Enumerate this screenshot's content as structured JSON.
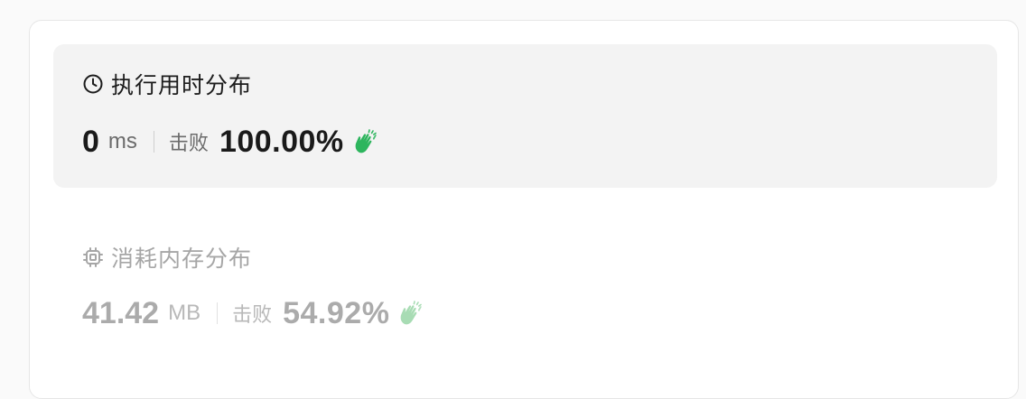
{
  "runtime": {
    "title": "执行用时分布",
    "icon": "clock-icon",
    "value": "0",
    "unit": "ms",
    "beat_label": "击败",
    "beat_percent": "100.00%",
    "clap_color": "#2db55d"
  },
  "memory": {
    "title": "消耗内存分布",
    "icon": "cpu-chip-icon",
    "value": "41.42",
    "unit": "MB",
    "beat_label": "击败",
    "beat_percent": "54.92%",
    "clap_color": "#a8dcb4"
  }
}
